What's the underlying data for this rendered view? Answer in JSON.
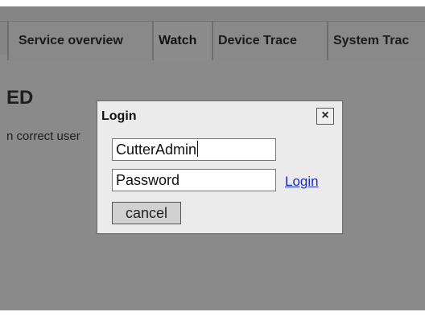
{
  "tabs": {
    "service_overview": "Service overview",
    "watch": "Watch",
    "device_trace": "Device Trace",
    "system_trace": "System Trac"
  },
  "page": {
    "heading": "ED",
    "message": "n correct user"
  },
  "dialog": {
    "title": "Login",
    "close_icon": "×",
    "username_value": "CutterAdmin",
    "password_value": "Password",
    "login_link": "Login",
    "cancel_label": "cancel"
  },
  "colors": {
    "overlay": "#8a8a8a",
    "dialog_bg": "#ebebeb",
    "link": "#1b2cc0"
  }
}
